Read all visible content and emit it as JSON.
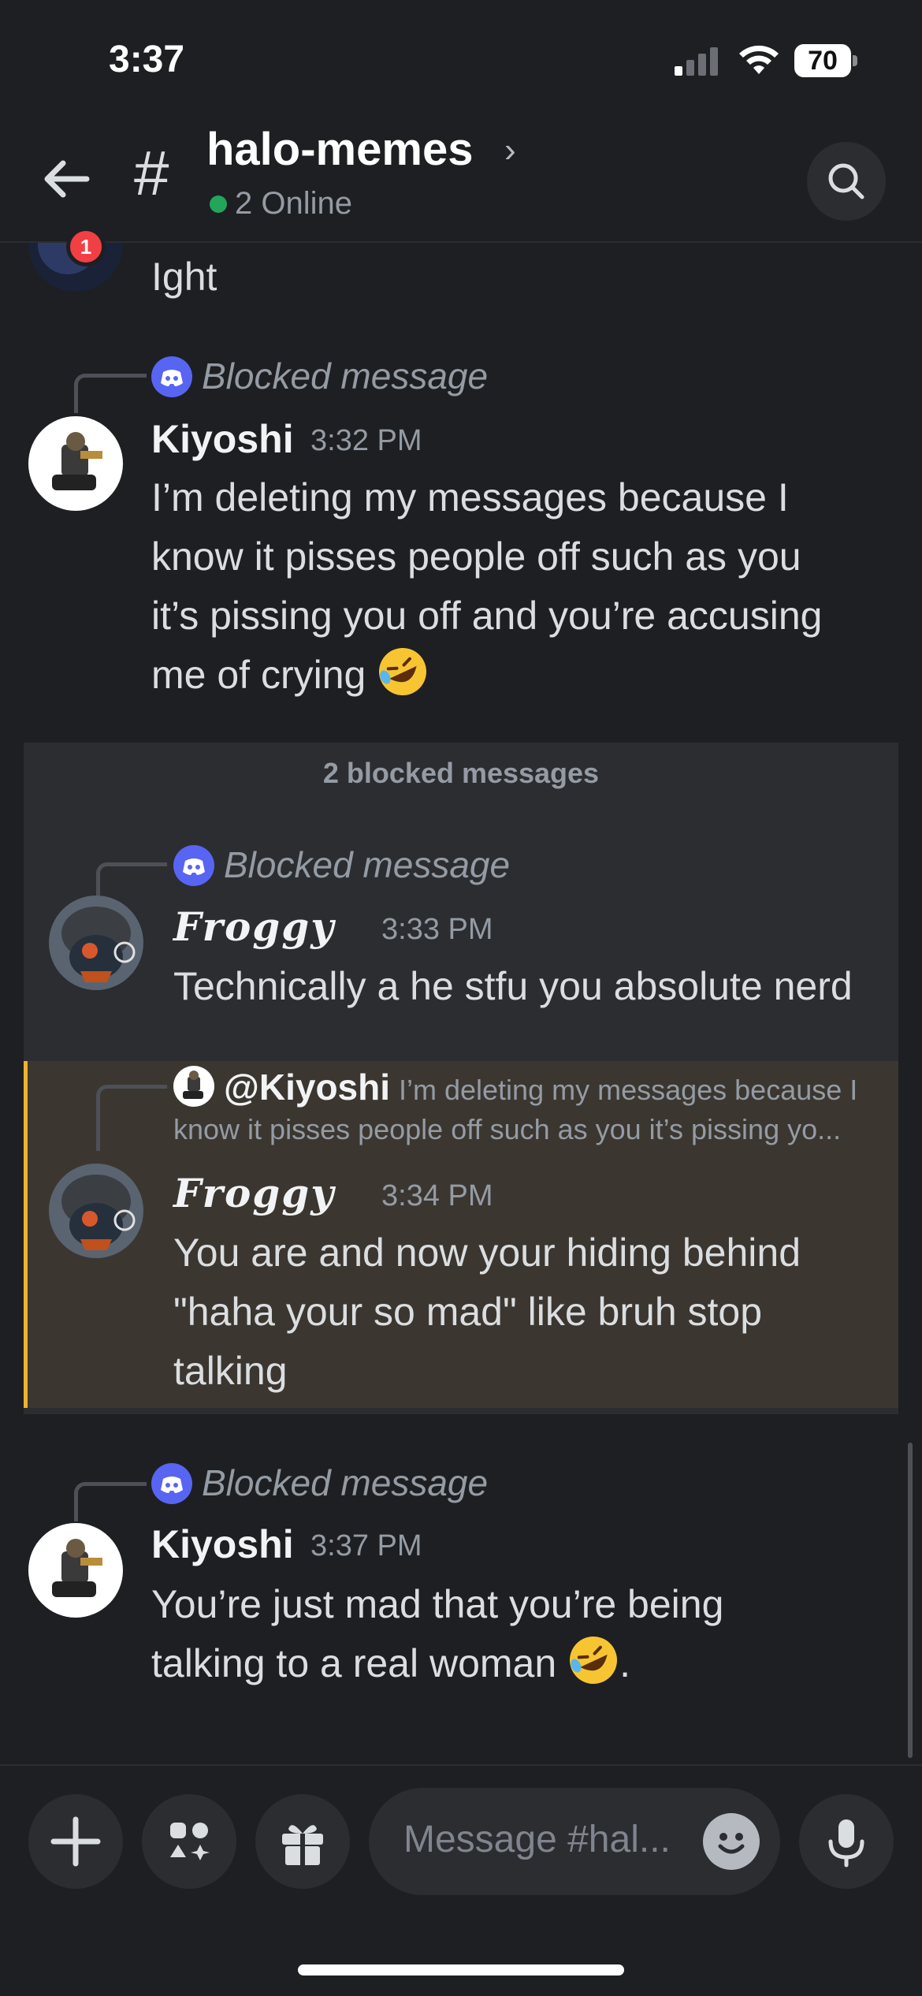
{
  "status_bar": {
    "time": "3:37",
    "battery": "70"
  },
  "header": {
    "back_badge": "1",
    "hash": "#",
    "channel_name": "halo-memes",
    "chevron": "›",
    "online_text": "2 Online"
  },
  "messages": {
    "prev": {
      "text": "Ight"
    },
    "m1": {
      "reply_label": "Blocked message",
      "username": "Kiyoshi",
      "time": "3:32 PM",
      "lines": [
        "I’m deleting my messages because I",
        "know it pisses people off such as you",
        "it’s pissing you off and you’re accusing",
        "me of crying"
      ]
    },
    "blocked_group": {
      "title": "2 blocked messages",
      "b1": {
        "reply_label": "Blocked message",
        "username": "Froggy",
        "time": "3:33 PM",
        "text": "Technically a he stfu you absolute nerd"
      },
      "b2": {
        "reply_username": "@Kiyoshi",
        "reply_text_1": "I’m deleting my messages because I",
        "reply_text_2": "know it pisses people off such as you it’s pissing yo...",
        "username": "Froggy",
        "time": "3:34 PM",
        "lines": [
          "You are and now your hiding behind",
          "\"haha your so mad\" like bruh stop",
          "talking"
        ]
      }
    },
    "m2": {
      "reply_label": "Blocked message",
      "username": "Kiyoshi",
      "time": "3:37 PM",
      "line1": "You’re just mad that you’re being",
      "line2": "talking to a real woman",
      "line2_suffix": "."
    }
  },
  "composer": {
    "placeholder": "Message #hal..."
  },
  "icons": [
    "back-arrow-icon",
    "hash-icon",
    "search-icon",
    "plus-icon",
    "apps-icon",
    "gift-icon",
    "emoji-icon",
    "microphone-icon",
    "discord-logo-icon",
    "rofl-emoji-icon"
  ],
  "colors": {
    "background": "#1e1f22",
    "panel": "#2b2d31",
    "online": "#23a55a",
    "badge": "#f23f43",
    "blurple": "#5865f2",
    "highlight": "#3b3730",
    "highlight_border": "#f0b232"
  }
}
